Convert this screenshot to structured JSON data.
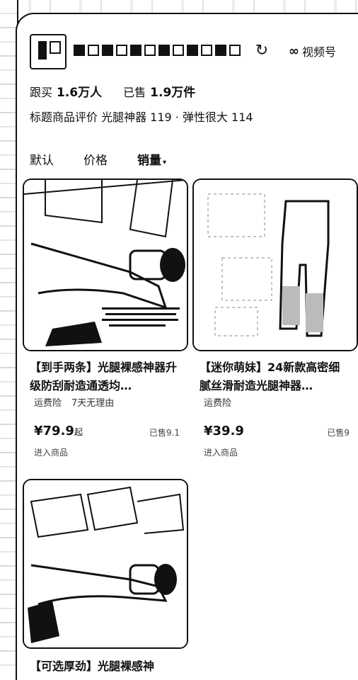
{
  "header": {
    "shop_name": "",
    "refresh_icon": "refresh-icon",
    "video_label": "视频号",
    "video_icon": "video-channel-icon"
  },
  "stats": {
    "follow_label": "跟买",
    "follow_value": "1.6万人",
    "sold_label": "已售",
    "sold_value": "1.9万件"
  },
  "review_line": "标题商品评价  光腿神器 119 · 弹性很大 114",
  "tabs": {
    "default": "默认",
    "price": "价格",
    "sales": "销量"
  },
  "products": [
    {
      "title": "【到手两条】光腿裸感神器升级防刮耐造通透均…",
      "tags": [
        "运费险",
        "7天无理由"
      ],
      "price": "¥79.9",
      "price_suffix": "起",
      "sold": "已售9.1",
      "enter": "进入商品"
    },
    {
      "title": "【迷你萌妹】24新款高密细腻丝滑耐造光腿神器…",
      "tags": [
        "运费险"
      ],
      "price": "¥39.9",
      "price_suffix": "",
      "sold": "已售9",
      "enter": "进入商品"
    },
    {
      "title": "【可选厚劲】光腿裸感神",
      "tags": [],
      "price": "",
      "price_suffix": "",
      "sold": "",
      "enter": ""
    }
  ]
}
